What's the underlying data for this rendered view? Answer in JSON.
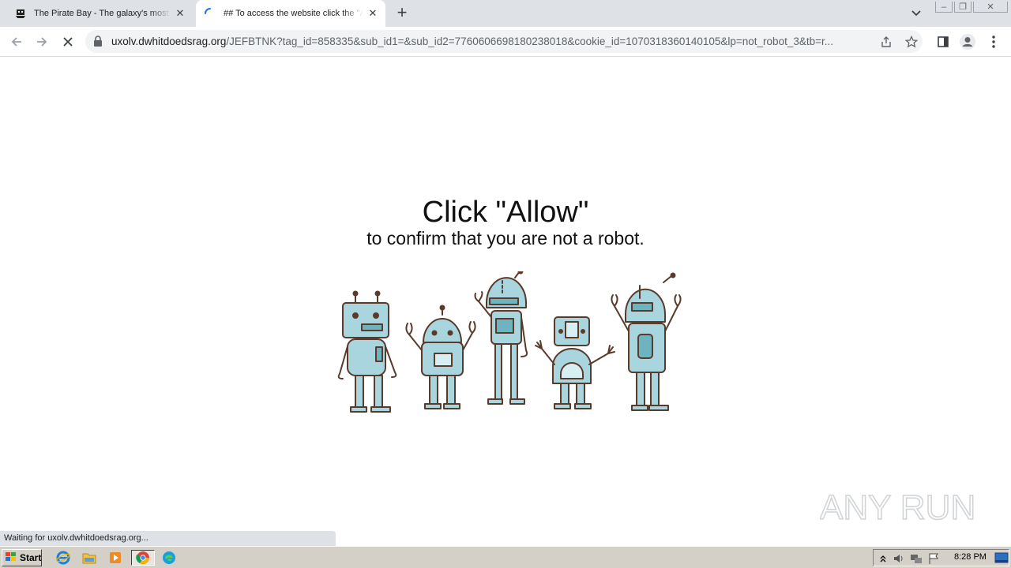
{
  "tabs": [
    {
      "title": "The Pirate Bay - The galaxy's most resilient BitTorrent site",
      "favicon": "pirate-ship-icon",
      "active": false
    },
    {
      "title": "## To access the website click the \"Allow\" button",
      "favicon": "loading-spinner-icon",
      "active": true
    }
  ],
  "window": {
    "minimize": "‒",
    "restore": "❐",
    "close": "✕"
  },
  "address_bar": {
    "host": "uxolv.dwhitdoedsrag.org",
    "path": "/JEFBTNK?tag_id=858335&sub_id1=&sub_id2=7760606698180238018&cookie_id=1070318360140105&lp=not_robot_3&tb=r..."
  },
  "page": {
    "headline": "Click \"Allow\"",
    "subline": "to confirm that you are not a robot.",
    "illustration": "five-cartoon-robots",
    "status": "Waiting for uxolv.dwhitdoedsrag.org...",
    "watermark": "ANY RUN"
  },
  "taskbar": {
    "start_label": "Start",
    "quicklaunch": [
      "internet-explorer-icon",
      "file-explorer-icon",
      "media-player-icon",
      "chrome-icon",
      "edge-icon"
    ],
    "clock": "8:28 PM"
  },
  "colors": {
    "robot_fill": "#a9d6de",
    "robot_stroke": "#5a3a2a",
    "tab_bg": "#dee1e6",
    "taskbar": "#d4d0c8"
  }
}
